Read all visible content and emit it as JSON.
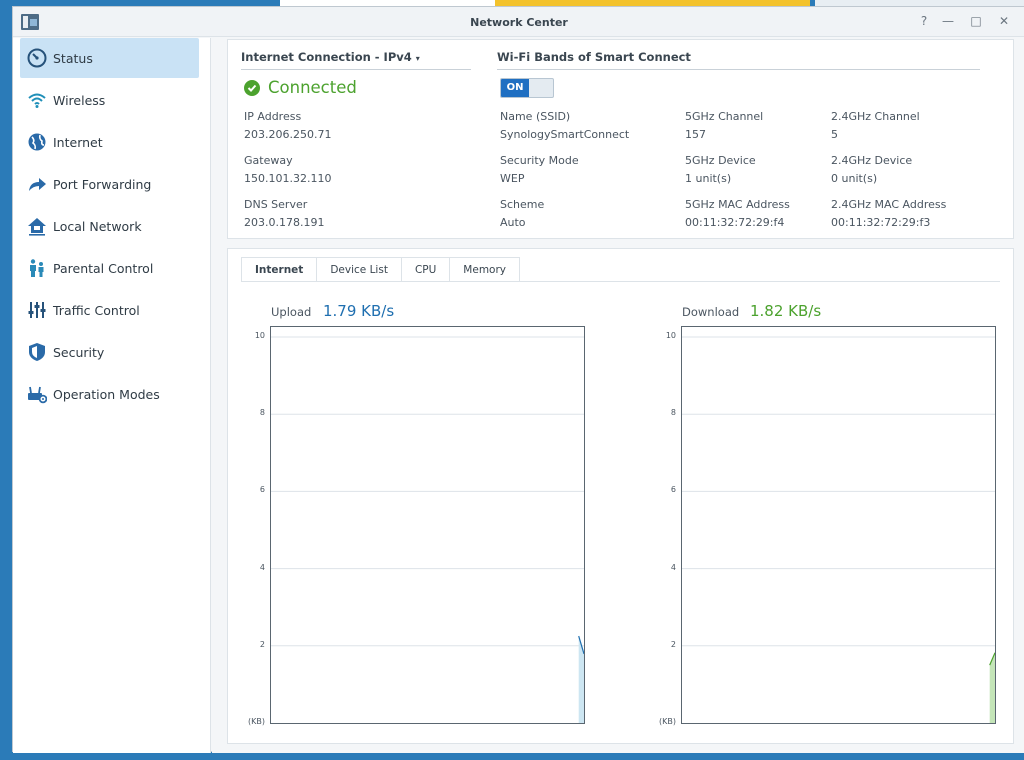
{
  "window": {
    "title": "Network Center",
    "help_glyph": "?",
    "minimize_glyph": "—",
    "maximize_glyph": "□",
    "close_glyph": "✕"
  },
  "sidebar": {
    "items": [
      {
        "label": "Status",
        "icon": "gauge-icon",
        "active": true
      },
      {
        "label": "Wireless",
        "icon": "wifi-icon"
      },
      {
        "label": "Internet",
        "icon": "globe-icon"
      },
      {
        "label": "Port Forwarding",
        "icon": "arrow-forward-icon"
      },
      {
        "label": "Local Network",
        "icon": "home-network-icon"
      },
      {
        "label": "Parental Control",
        "icon": "family-icon"
      },
      {
        "label": "Traffic Control",
        "icon": "sliders-icon"
      },
      {
        "label": "Security",
        "icon": "shield-icon"
      },
      {
        "label": "Operation Modes",
        "icon": "router-gear-icon"
      }
    ]
  },
  "internet": {
    "section_title": "Internet Connection - IPv4",
    "status": "Connected",
    "ip_label": "IP Address",
    "ip_value": "203.206.250.71",
    "gateway_label": "Gateway",
    "gateway_value": "150.101.32.110",
    "dns_label": "DNS Server",
    "dns_value": "203.0.178.191"
  },
  "wifi": {
    "section_title": "Wi-Fi Bands of Smart Connect",
    "toggle_label": "ON",
    "ssid_label": "Name (SSID)",
    "ssid_value": "SynologySmartConnect",
    "ch5_label": "5GHz Channel",
    "ch5_value": "157",
    "ch24_label": "2.4GHz Channel",
    "ch24_value": "5",
    "security_label": "Security Mode",
    "security_value": "WEP",
    "dev5_label": "5GHz Device",
    "dev5_value": "1 unit(s)",
    "dev24_label": "2.4GHz Device",
    "dev24_value": "0 unit(s)",
    "scheme_label": "Scheme",
    "scheme_value": "Auto",
    "mac5_label": "5GHz MAC Address",
    "mac5_value": "00:11:32:72:29:f4",
    "mac24_label": "2.4GHz MAC Address",
    "mac24_value": "00:11:32:72:29:f3"
  },
  "monitor": {
    "tabs": [
      "Internet",
      "Device List",
      "CPU",
      "Memory"
    ],
    "active_tab": 0,
    "upload_label": "Upload",
    "upload_value": "1.79 KB/s",
    "download_label": "Download",
    "download_value": "1.82 KB/s",
    "upload_color": "#1f6fb0",
    "download_color": "#4ca22e"
  },
  "chart_data": [
    {
      "type": "area",
      "title": "Upload",
      "ylabel": "(KB)",
      "ylim": [
        0,
        10
      ],
      "yticks": [
        "(KB)",
        "2",
        "4",
        "6",
        "8",
        "10"
      ],
      "grid": true,
      "series": [
        {
          "values": [
            0,
            0,
            0,
            0,
            0,
            0,
            0,
            0,
            0,
            0,
            0,
            0,
            0,
            0,
            0,
            0,
            0,
            0,
            0,
            0,
            0,
            0,
            0,
            0,
            0,
            0,
            0,
            0,
            0,
            0,
            0,
            0,
            0,
            0,
            0,
            0,
            0,
            0,
            0,
            0,
            0,
            0,
            0,
            0,
            0,
            0,
            0,
            0,
            0,
            0,
            0,
            0,
            0,
            0,
            0,
            0,
            0,
            0,
            2.25,
            1.79
          ],
          "color": "#1f6fb0",
          "fill": "#cde6f2"
        }
      ]
    },
    {
      "type": "area",
      "title": "Download",
      "ylabel": "(KB)",
      "ylim": [
        0,
        10
      ],
      "yticks": [
        "(KB)",
        "2",
        "4",
        "6",
        "8",
        "10"
      ],
      "grid": true,
      "series": [
        {
          "values": [
            0,
            0,
            0,
            0,
            0,
            0,
            0,
            0,
            0,
            0,
            0,
            0,
            0,
            0,
            0,
            0,
            0,
            0,
            0,
            0,
            0,
            0,
            0,
            0,
            0,
            0,
            0,
            0,
            0,
            0,
            0,
            0,
            0,
            0,
            0,
            0,
            0,
            0,
            0,
            0,
            0,
            0,
            0,
            0,
            0,
            0,
            0,
            0,
            0,
            0,
            0,
            0,
            0,
            0,
            0,
            0,
            0,
            0,
            1.5,
            1.82
          ],
          "color": "#4ca22e",
          "fill": "#c4e5b8"
        }
      ]
    }
  ]
}
